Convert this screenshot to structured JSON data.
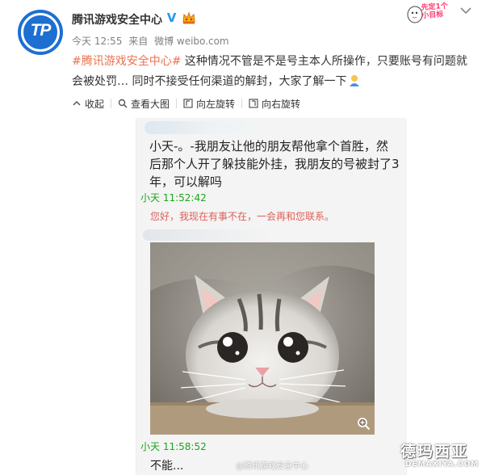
{
  "post": {
    "author": "腾讯游戏安全中心",
    "avatar_text": "TP",
    "verified_mark": "V",
    "meta": {
      "time": "今天 12:55",
      "source_prefix": "来自",
      "source": "微博 weibo.com"
    },
    "hashtag": "#腾讯游戏安全中心#",
    "text": " 这种情况不管是不是号主本人所操作，只要账号有问题就会被处罚… 同时不接受任何渠道的解封，大家了解一下"
  },
  "header_sticker": {
    "text_line1": "先定1个",
    "text_line2": "小目标"
  },
  "toolbar": {
    "collapse": "收起",
    "view_large": "查看大图",
    "rotate_left": "向左旋转",
    "rotate_right": "向右旋转"
  },
  "screenshot": {
    "message": "小天-。-我朋友让他的朋友帮他拿个首胜，然后那个人开了躲技能外挂，我朋友的号被封了3年，可以解吗",
    "timestamp_1": "小天 11:52:42",
    "auto_reply": "您好，我现在有事不在，一会再和您联系。",
    "timestamp_2": "小天 11:58:52",
    "reply_2": "不能..."
  },
  "watermarks": {
    "weibo": "@腾讯游戏安全中心",
    "site_cn": "德玛西亚",
    "site_en": "DEMAXIYA.COM"
  },
  "colors": {
    "hashtag": "#eb7350",
    "verified": "#1d9bf0",
    "chat_timestamp": "#1aa61a",
    "auto_reply": "#e0605a",
    "avatar_bg": "#1d6fd1"
  }
}
